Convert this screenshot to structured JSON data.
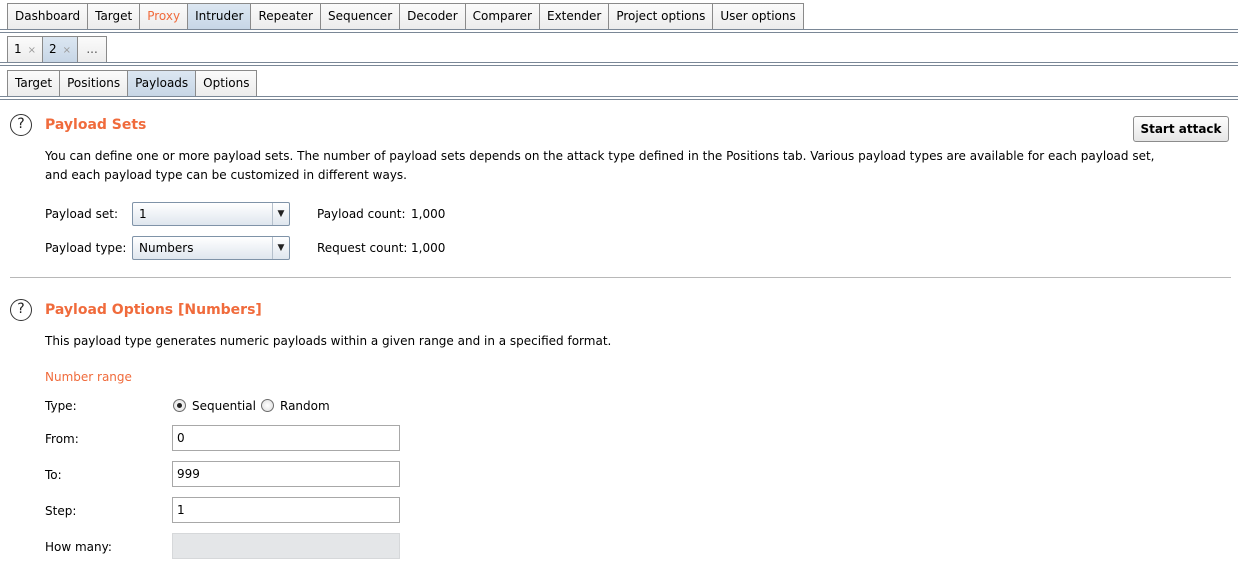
{
  "top_tabs": [
    "Dashboard",
    "Target",
    "Proxy",
    "Intruder",
    "Repeater",
    "Sequencer",
    "Decoder",
    "Comparer",
    "Extender",
    "Project options",
    "User options"
  ],
  "active_top_tab": "Intruder",
  "attack_tabs": [
    {
      "label": "1",
      "close": "×"
    },
    {
      "label": "2",
      "close": "×"
    }
  ],
  "attack_tab_more": "...",
  "sub_tabs": [
    "Target",
    "Positions",
    "Payloads",
    "Options"
  ],
  "active_sub_tab": "Payloads",
  "payload_sets": {
    "title": "Payload Sets",
    "description_line1": "You can define one or more payload sets. The number of payload sets depends on the attack type defined in the Positions tab. Various payload types are available for each payload set,",
    "description_line2": "and each payload type can be customized in different ways.",
    "payload_set_label": "Payload set:",
    "payload_set_value": "1",
    "payload_type_label": "Payload type:",
    "payload_type_value": "Numbers",
    "payload_count_label": "Payload count:",
    "payload_count_value": "1,000",
    "request_count_label": "Request count:",
    "request_count_value": "1,000",
    "start_attack": "Start attack"
  },
  "payload_options": {
    "title": "Payload Options [Numbers]",
    "description": "This payload type generates numeric payloads within a given range and in a specified format.",
    "number_range_heading": "Number range",
    "type_label": "Type:",
    "type_options": [
      "Sequential",
      "Random"
    ],
    "type_selected": "Sequential",
    "from_label": "From:",
    "from_value": "0",
    "to_label": "To:",
    "to_value": "999",
    "step_label": "Step:",
    "step_value": "1",
    "how_many_label": "How many:",
    "how_many_value": ""
  },
  "icons": {
    "help": "question-circle-icon",
    "dropdown": "chevron-down-icon"
  },
  "colors": {
    "accent": "#f06b3c",
    "active_tab": "#c7d6e6"
  }
}
